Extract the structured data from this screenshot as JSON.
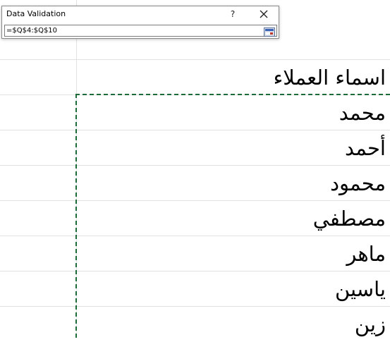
{
  "dialog": {
    "title": "Data Validation",
    "help_label": "?",
    "close_icon": "close-icon",
    "reference_value": "=$Q$4:$Q$10",
    "collapse_icon": "range-select-icon"
  },
  "sheet": {
    "header": "اسماء العملاء",
    "items": [
      "محمد",
      "أحمد",
      "محمود",
      "مصطفي",
      "ماهر",
      "ياسين",
      "زين"
    ],
    "selection_color": "#1e6b3a",
    "gridline_color": "#e1e1e1"
  }
}
